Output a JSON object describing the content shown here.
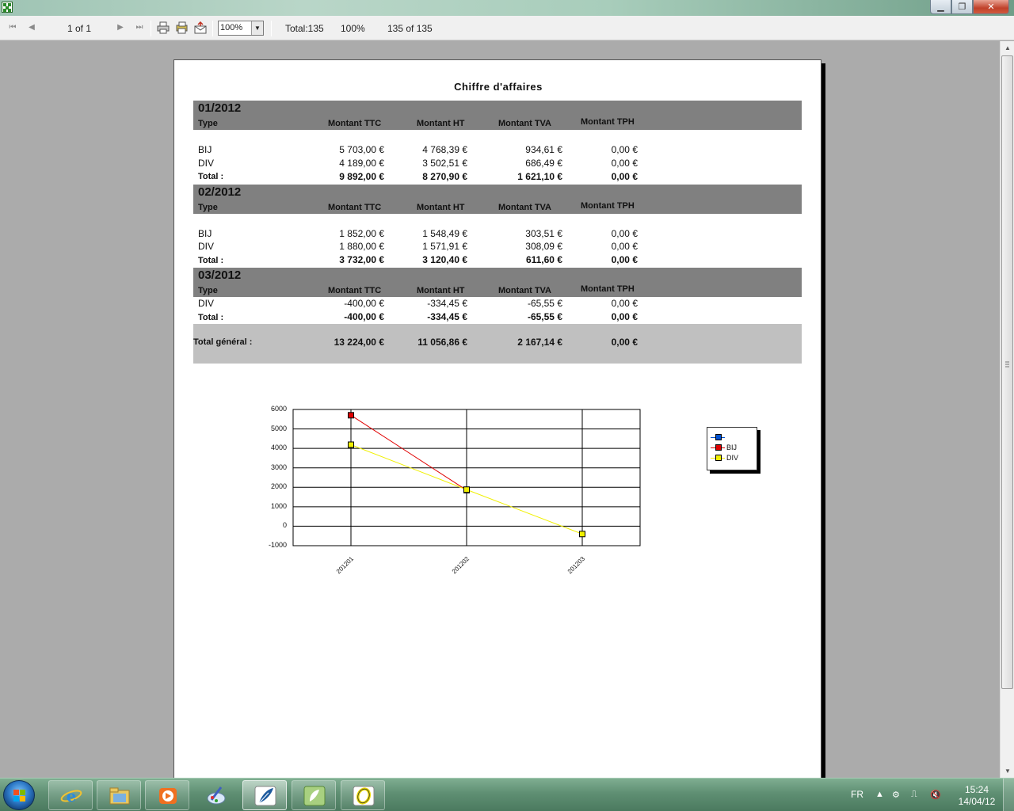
{
  "toolbar": {
    "page_indicator": "1 of 1",
    "zoom_value": "100%",
    "total_label": "Total:135",
    "percent_label": "100%",
    "record_label": "135 of 135"
  },
  "report": {
    "title": "Chiffre d'affaires",
    "columns": {
      "type": "Type",
      "ttc": "Montant TTC",
      "ht": "Montant HT",
      "tva": "Montant TVA",
      "tph": "Montant TPH"
    },
    "groups": [
      {
        "period": "01/2012",
        "rows": [
          {
            "type": "BIJ",
            "ttc": "5 703,00 €",
            "ht": "4 768,39 €",
            "tva": "934,61 €",
            "tph": "0,00 €"
          },
          {
            "type": "DIV",
            "ttc": "4 189,00 €",
            "ht": "3 502,51 €",
            "tva": "686,49 €",
            "tph": "0,00 €"
          }
        ],
        "total": {
          "label": "Total :",
          "ttc": "9 892,00 €",
          "ht": "8 270,90 €",
          "tva": "1 621,10 €",
          "tph": "0,00 €"
        }
      },
      {
        "period": "02/2012",
        "rows": [
          {
            "type": "BIJ",
            "ttc": "1 852,00 €",
            "ht": "1 548,49 €",
            "tva": "303,51 €",
            "tph": "0,00 €"
          },
          {
            "type": "DIV",
            "ttc": "1 880,00 €",
            "ht": "1 571,91 €",
            "tva": "308,09 €",
            "tph": "0,00 €"
          }
        ],
        "total": {
          "label": "Total :",
          "ttc": "3 732,00 €",
          "ht": "3 120,40 €",
          "tva": "611,60 €",
          "tph": "0,00 €"
        }
      },
      {
        "period": "03/2012",
        "rows": [
          {
            "type": "DIV",
            "ttc": "-400,00 €",
            "ht": "-334,45 €",
            "tva": "-65,55 €",
            "tph": "0,00 €"
          }
        ],
        "total": {
          "label": "Total :",
          "ttc": "-400,00 €",
          "ht": "-334,45 €",
          "tva": "-65,55 €",
          "tph": "0,00 €"
        }
      }
    ],
    "grand_total": {
      "label": "Total général :",
      "ttc": "13 224,00 €",
      "ht": "11 056,86 €",
      "tva": "2 167,14 €",
      "tph": "0,00 €"
    }
  },
  "chart_data": {
    "type": "line",
    "categories": [
      "201201",
      "201202",
      "201203"
    ],
    "ylim": [
      -1000,
      6000
    ],
    "y_ticks": [
      6000,
      5000,
      4000,
      3000,
      2000,
      1000,
      0,
      -1000
    ],
    "grid": true,
    "legend_position": "right",
    "series": [
      {
        "name": "",
        "color": "#0050d0",
        "values": [
          null,
          null,
          null
        ]
      },
      {
        "name": "BIJ",
        "color": "#e00000",
        "values": [
          5703,
          1852,
          null
        ]
      },
      {
        "name": "DIV",
        "color": "#f0f000",
        "values": [
          4189,
          1880,
          -400
        ]
      }
    ]
  },
  "taskbar": {
    "language": "FR",
    "time": "15:24",
    "date": "14/04/12",
    "apps": [
      "internet-explorer",
      "file-explorer",
      "media-player",
      "paint",
      "feather-app",
      "app-green",
      "app-ring"
    ]
  }
}
